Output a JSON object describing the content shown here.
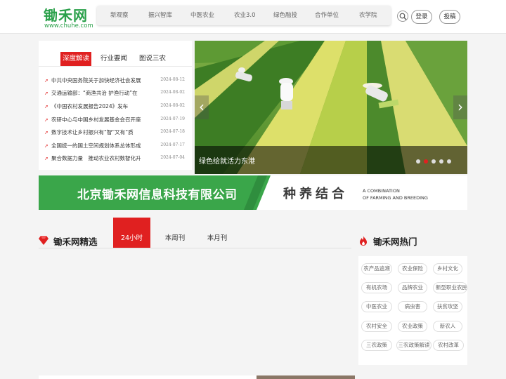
{
  "header": {
    "logo_text": "锄禾网",
    "logo_url": "www.chuhe.com",
    "nav": [
      "新观察",
      "振兴智库",
      "中医农业",
      "农业3.0",
      "绿色融投",
      "合作单位",
      "农学院"
    ],
    "login_label": "登录",
    "submit_label": "投稿",
    "search_icon": "search-icon"
  },
  "news": {
    "tabs": [
      "深度解读",
      "行业要闻",
      "图说三农"
    ],
    "active_tab": 0,
    "items": [
      {
        "title": "中共中央国务院关于加快经济社会发展",
        "date": "2024-08-12"
      },
      {
        "title": "交通运输部：“商渔共治 护渔行动”在",
        "date": "2024-08-02"
      },
      {
        "title": "《中国农村发展报告2024》发布",
        "date": "2024-08-02"
      },
      {
        "title": "农研中心与中国乡村发展基金会召开座",
        "date": "2024-07-19"
      },
      {
        "title": "数字技术让乡村振兴有“智”又有“质",
        "date": "2024-07-18"
      },
      {
        "title": "全国统一的国土空间规划体系总体形成",
        "date": "2024-07-17"
      },
      {
        "title": "聚合数据力量　推动农业农村数智化升",
        "date": "2024-07-04"
      }
    ]
  },
  "slider": {
    "caption": "绿色绘就活力东港",
    "dot_count": 5,
    "active_dot": 1,
    "prev_glyph": "‹",
    "next_glyph": "›"
  },
  "banner": {
    "company": "北京锄禾网信息科技有限公司",
    "slogan": "种养结合",
    "en_line1": "A COMBINATION",
    "en_line2": "OF FARMING AND BREEDING",
    "green": "#3aa64a"
  },
  "featured": {
    "title": "锄禾网精选",
    "icon": "diamond-icon",
    "tabs": [
      "24小时",
      "本周刊",
      "本月刊"
    ],
    "active_tab": 0
  },
  "hot": {
    "title": "锄禾网热门",
    "icon": "flame-icon",
    "tags": [
      [
        "农产品追溯",
        "农业保险",
        "乡村文化"
      ],
      [
        "有机农场",
        "品牌农业",
        "新型职业农民"
      ],
      [
        "中医农业",
        "病虫害",
        "扶贫攻坚"
      ],
      [
        "农村安全",
        "农业政策",
        "新农人"
      ],
      [
        "三农政策",
        "三农政策解读",
        "农村改革"
      ]
    ]
  },
  "colors": {
    "accent": "#e02020",
    "brand_green": "#2aa04a"
  }
}
